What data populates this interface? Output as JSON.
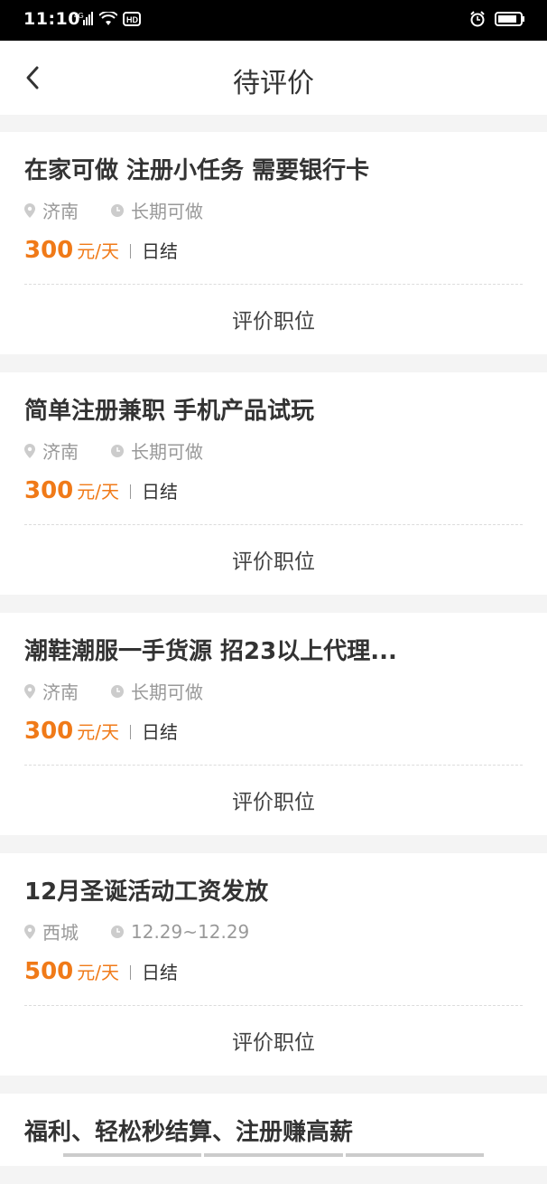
{
  "status_bar": {
    "time": "11:10",
    "network": "4G",
    "hd": "HD"
  },
  "header": {
    "title": "待评价",
    "back_icon": "chevron-left-icon"
  },
  "jobs": [
    {
      "title": "在家可做 注册小任务 需要银行卡",
      "location": "济南",
      "period": "长期可做",
      "amount": "300",
      "unit": "元/天",
      "settle": "日结",
      "action": "评价职位"
    },
    {
      "title": "简单注册兼职 手机产品试玩",
      "location": "济南",
      "period": "长期可做",
      "amount": "300",
      "unit": "元/天",
      "settle": "日结",
      "action": "评价职位"
    },
    {
      "title": "潮鞋潮服一手货源 招23以上代理...",
      "location": "济南",
      "period": "长期可做",
      "amount": "300",
      "unit": "元/天",
      "settle": "日结",
      "action": "评价职位"
    },
    {
      "title": "12月圣诞活动工资发放",
      "location": "西城",
      "period": "12.29~12.29",
      "amount": "500",
      "unit": "元/天",
      "settle": "日结",
      "action": "评价职位"
    },
    {
      "title": "福利、轻松秒结算、注册赚高薪"
    }
  ],
  "colors": {
    "accent": "#f07a18",
    "text": "#333333",
    "muted": "#999999",
    "background": "#f4f4f4"
  }
}
